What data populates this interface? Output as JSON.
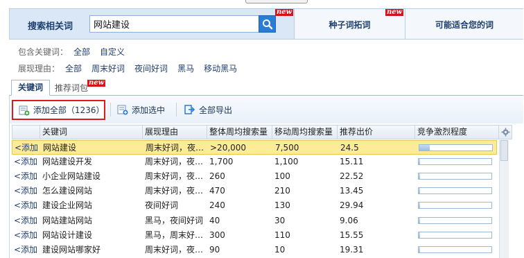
{
  "header": {
    "search_label": "搜索相关词",
    "search_value": "网站建设",
    "new_badge": "new",
    "tab_seed": "种子词拓词",
    "tab_suitable": "可能适合您的词"
  },
  "filters": {
    "contain_label": "包含关键词：",
    "contain_options": [
      "全部",
      "自定义"
    ],
    "reason_label": "展现理由：",
    "reason_options": [
      "全部",
      "周末好词",
      "夜间好词",
      "黑马",
      "移动黑马"
    ]
  },
  "section_tabs": {
    "keywords": "关键词",
    "recommended": "推荐词包"
  },
  "toolbar": {
    "add_all": "添加全部（1236）",
    "add_selected": "添加选中",
    "export_all": "全部导出"
  },
  "table": {
    "columns": [
      "关键词",
      "展现理由",
      "整体周均搜索量",
      "移动周均搜索量",
      "推荐出价",
      "竞争激烈程度"
    ],
    "add_label": "<添加",
    "rows": [
      {
        "keyword": "网站建设",
        "reason": "周末好词，夜…",
        "total": ">20,000",
        "mobile": "7,500",
        "bid": "24.5",
        "competition": 0.14,
        "selected": true
      },
      {
        "keyword": "网站建设开发",
        "reason": "周末好词，夜…",
        "total": "1,700",
        "mobile": "1,100",
        "bid": "15.11",
        "competition": 0.02
      },
      {
        "keyword": "小企业网站建设",
        "reason": "周末好词，夜…",
        "total": "260",
        "mobile": "100",
        "bid": "22.52",
        "competition": 0.02
      },
      {
        "keyword": "怎么建设网站",
        "reason": "周末好词，夜…",
        "total": "470",
        "mobile": "210",
        "bid": "13.45",
        "competition": 0.02
      },
      {
        "keyword": "建设企业网站",
        "reason": "夜间好词",
        "total": "240",
        "mobile": "130",
        "bid": "29.94",
        "competition": 0.02
      },
      {
        "keyword": "网站建站网站",
        "reason": "黑马，夜间好词",
        "total": "40",
        "mobile": "30",
        "bid": "9.06",
        "competition": 0.02
      },
      {
        "keyword": "网站设计建设",
        "reason": "黑马，周末好…",
        "total": "300",
        "mobile": "110",
        "bid": "15.55",
        "competition": 0.02
      },
      {
        "keyword": "建设网站哪家好",
        "reason": "周末好词，夜…",
        "total": "90",
        "mobile": "10",
        "bid": "19.31",
        "competition": 0.02
      }
    ]
  },
  "colors": {
    "accent": "#2a7dd6",
    "highlight_border": "#e01a1a",
    "selected_row": "#fdeb9a"
  }
}
